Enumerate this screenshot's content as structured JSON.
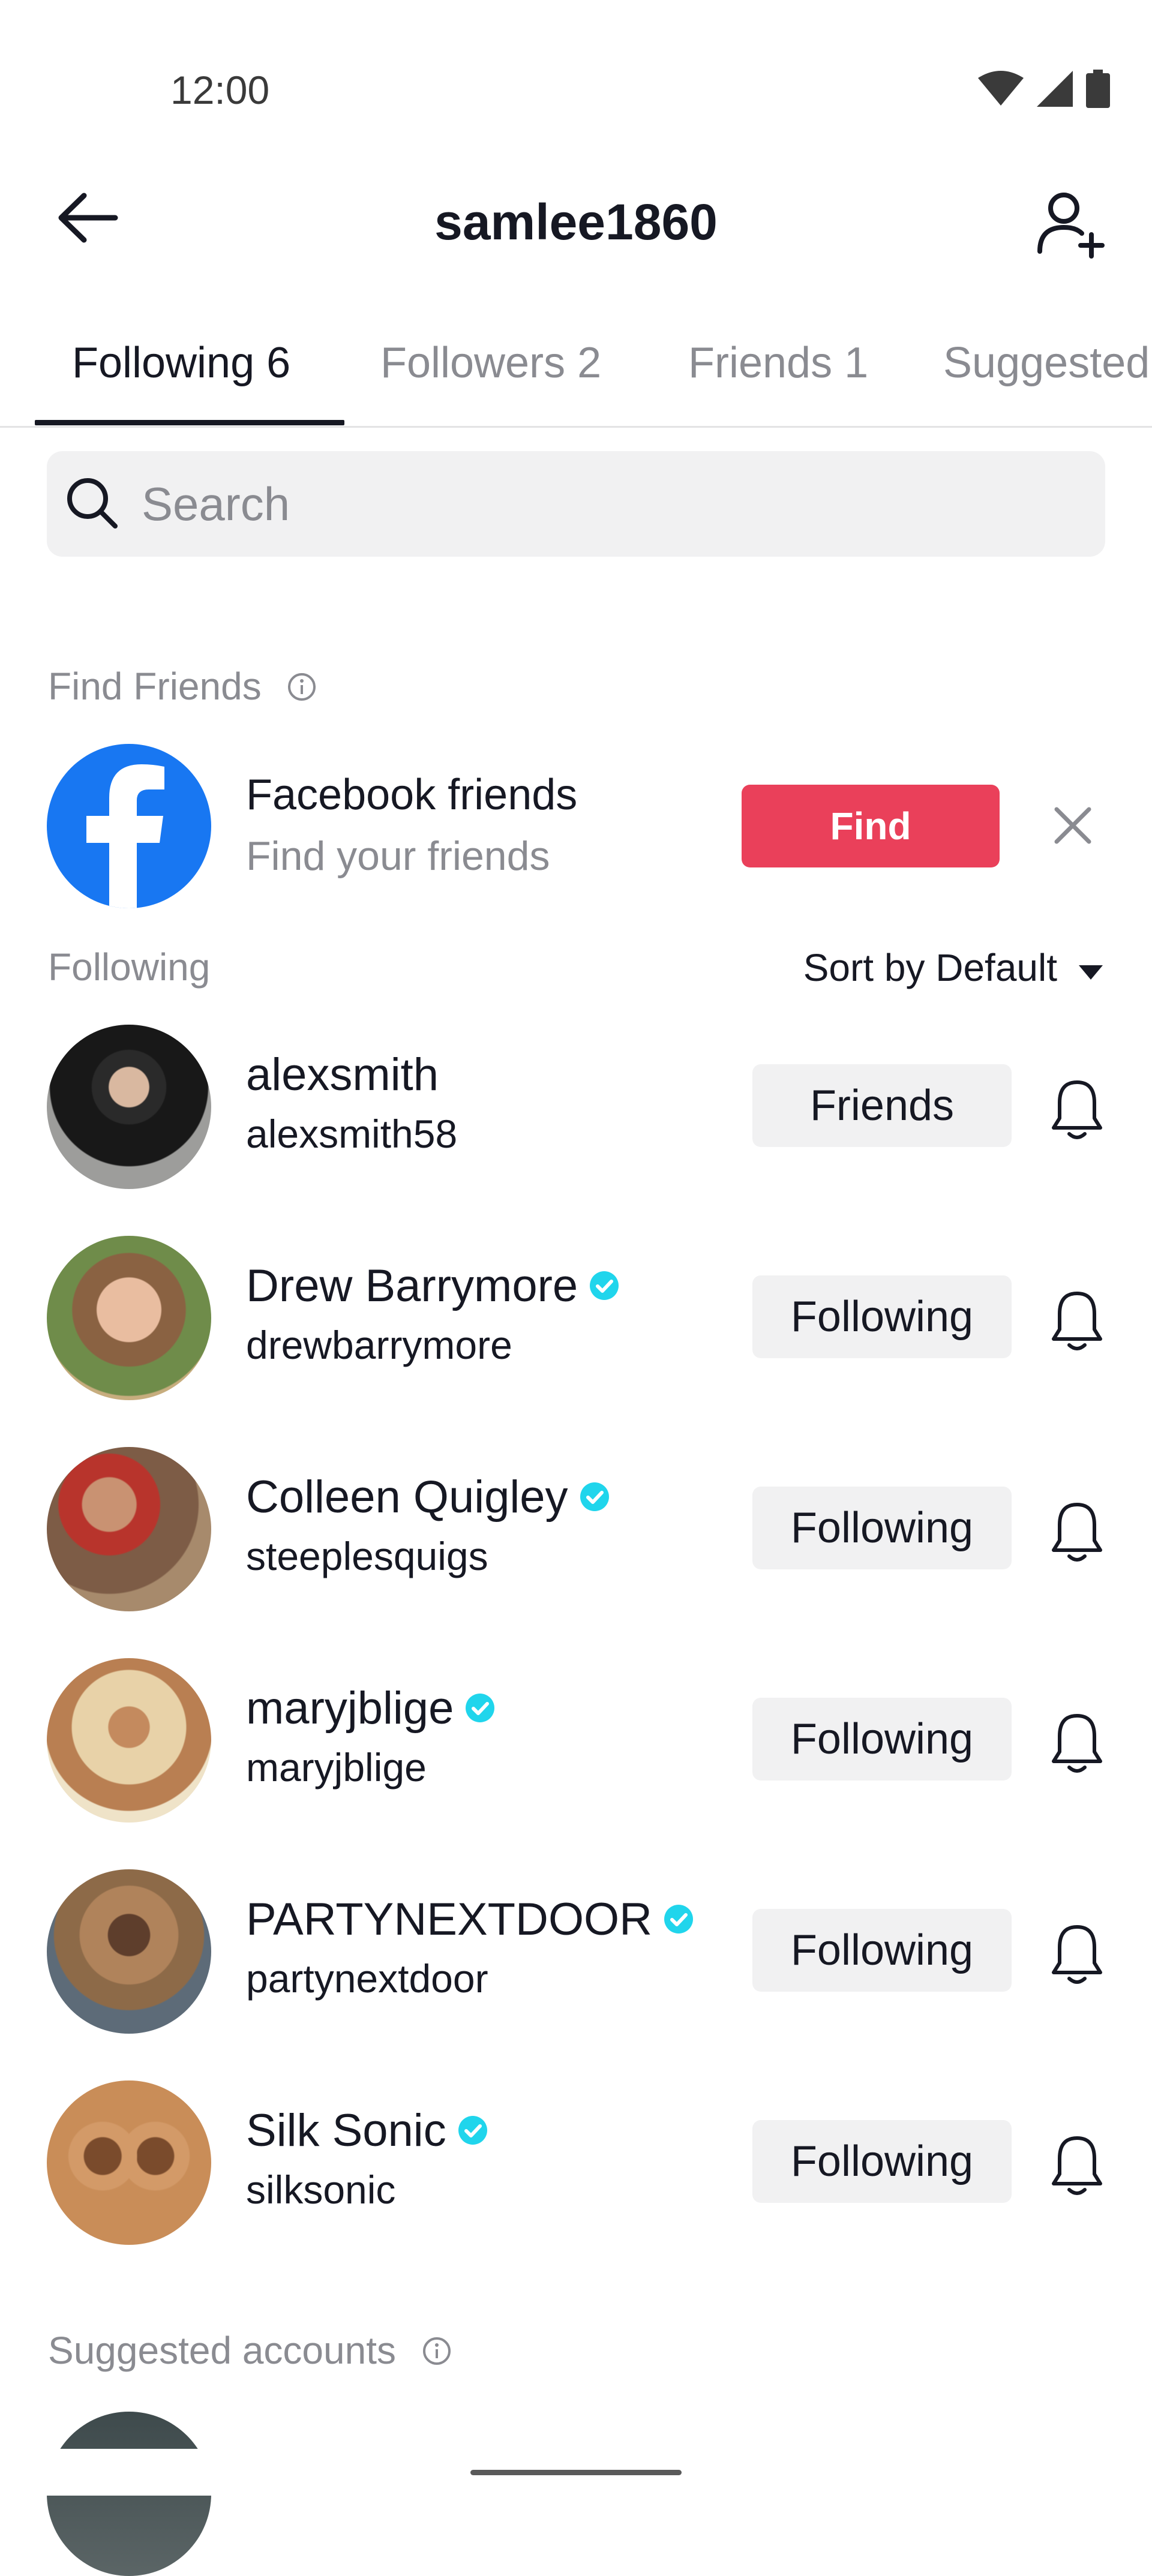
{
  "status_bar": {
    "time": "12:00"
  },
  "header": {
    "title": "samlee1860"
  },
  "tabs": [
    {
      "label": "Following 6"
    },
    {
      "label": "Followers 2"
    },
    {
      "label": "Friends 1"
    },
    {
      "label": "Suggested"
    }
  ],
  "search": {
    "placeholder": "Search"
  },
  "find_friends": {
    "label": "Find Friends",
    "facebook": {
      "title": "Facebook friends",
      "subtitle": "Find your friends",
      "button": "Find"
    }
  },
  "following": {
    "label": "Following",
    "sort_label": "Sort by Default",
    "users": [
      {
        "name": "alexsmith",
        "handle": "alexsmith58",
        "verified": false,
        "button": "Friends"
      },
      {
        "name": "Drew Barrymore",
        "handle": "drewbarrymore",
        "verified": true,
        "button": "Following"
      },
      {
        "name": "Colleen Quigley",
        "handle": "steeplesquigs",
        "verified": true,
        "button": "Following"
      },
      {
        "name": "maryjblige",
        "handle": "maryjblige",
        "verified": true,
        "button": "Following"
      },
      {
        "name": "PARTYNEXTDOOR",
        "handle": "partynextdoor",
        "verified": true,
        "button": "Following"
      },
      {
        "name": "Silk Sonic",
        "handle": "silksonic",
        "verified": true,
        "button": "Following"
      }
    ]
  },
  "suggested": {
    "label": "Suggested accounts"
  },
  "colors": {
    "accent": "#ea405a",
    "facebook": "#1877f2",
    "verified": "#20d5ec"
  }
}
